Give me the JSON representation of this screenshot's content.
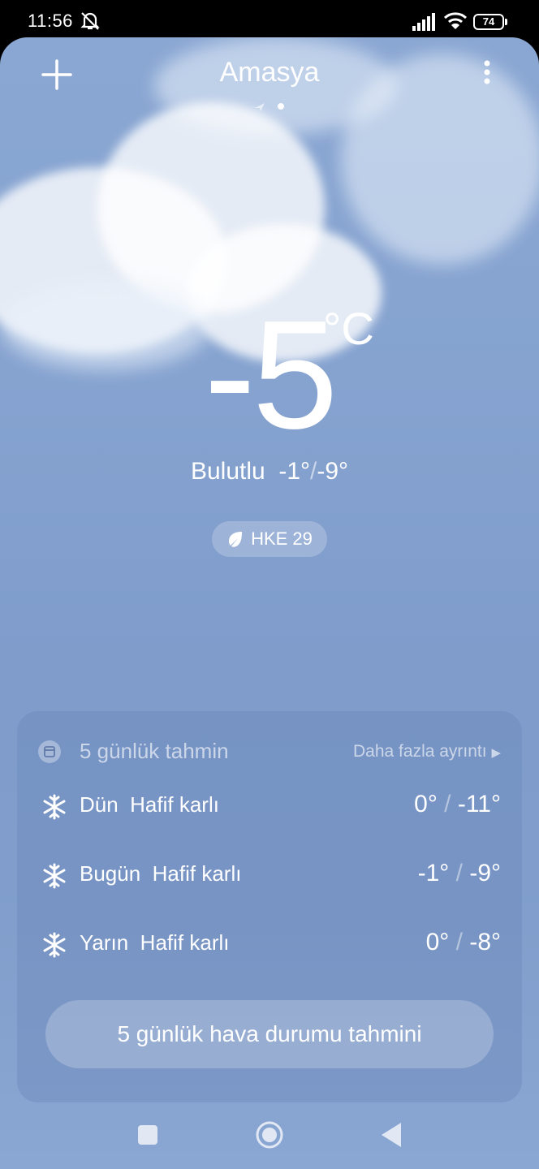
{
  "status_bar": {
    "time": "11:56",
    "battery": "74",
    "icons": [
      "mute-icon",
      "signal-icon",
      "wifi-icon",
      "battery-icon"
    ]
  },
  "header": {
    "city": "Amasya",
    "add_icon": "plus-icon",
    "menu_icon": "more-vertical-icon"
  },
  "current": {
    "temperature": "-5",
    "unit": "°C",
    "condition": "Bulutlu",
    "high": "-1°",
    "separator": "/",
    "low": "-9°",
    "aqi_label": "HKE 29"
  },
  "forecast": {
    "title": "5 günlük tahmin",
    "more_link": "Daha fazla ayrıntı",
    "rows": [
      {
        "day": "Dün",
        "condition": "Hafif karlı",
        "high": "0°",
        "low": "-11°"
      },
      {
        "day": "Bugün",
        "condition": "Hafif karlı",
        "high": "-1°",
        "low": "-9°"
      },
      {
        "day": "Yarın",
        "condition": "Hafif karlı",
        "high": "0°",
        "low": "-8°"
      }
    ],
    "button_label": "5 günlük hava durumu tahmini"
  },
  "colors": {
    "sky_top": "#8aa7d3",
    "sky_bottom": "#8aa6d2",
    "card": "#6c88ba"
  }
}
